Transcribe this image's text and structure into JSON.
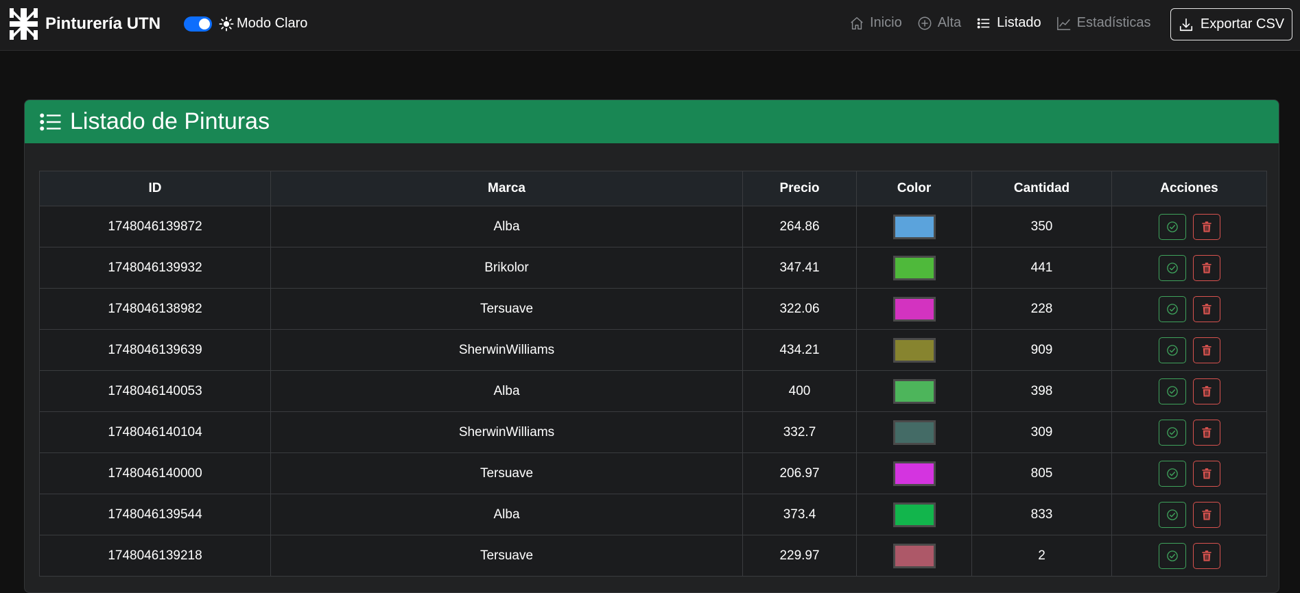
{
  "app": {
    "title": "Pinturería UTN"
  },
  "theme": {
    "label": "Modo Claro",
    "toggle_on": true
  },
  "nav": {
    "items": [
      {
        "label": "Inicio",
        "icon": "house-icon",
        "active": false
      },
      {
        "label": "Alta",
        "icon": "plus-circle-icon",
        "active": false
      },
      {
        "label": "Listado",
        "icon": "list-icon",
        "active": true
      },
      {
        "label": "Estadísticas",
        "icon": "chart-icon",
        "active": false
      }
    ],
    "export_label": "Exportar CSV"
  },
  "card": {
    "title": "Listado de Pinturas"
  },
  "table": {
    "headers": [
      "ID",
      "Marca",
      "Precio",
      "Color",
      "Cantidad",
      "Acciones"
    ],
    "rows": [
      {
        "id": "1748046139872",
        "marca": "Alba",
        "precio": "264.86",
        "color": "#5ba3dc",
        "cantidad": "350"
      },
      {
        "id": "1748046139932",
        "marca": "Brikolor",
        "precio": "347.41",
        "color": "#4fb93b",
        "cantidad": "441"
      },
      {
        "id": "1748046138982",
        "marca": "Tersuave",
        "precio": "322.06",
        "color": "#d333c0",
        "cantidad": "228"
      },
      {
        "id": "1748046139639",
        "marca": "SherwinWilliams",
        "precio": "434.21",
        "color": "#87842f",
        "cantidad": "909"
      },
      {
        "id": "1748046140053",
        "marca": "Alba",
        "precio": "400",
        "color": "#4db55b",
        "cantidad": "398"
      },
      {
        "id": "1748046140104",
        "marca": "SherwinWilliams",
        "precio": "332.7",
        "color": "#446b66",
        "cantidad": "309"
      },
      {
        "id": "1748046140000",
        "marca": "Tersuave",
        "precio": "206.97",
        "color": "#d434e0",
        "cantidad": "805"
      },
      {
        "id": "1748046139544",
        "marca": "Alba",
        "precio": "373.4",
        "color": "#12b54c",
        "cantidad": "833"
      },
      {
        "id": "1748046139218",
        "marca": "Tersuave",
        "precio": "229.97",
        "color": "#ad5868",
        "cantidad": "2"
      }
    ]
  },
  "colors": {
    "accent": "#198754",
    "toggle": "#0d6efd",
    "ok": "#3fa35c",
    "danger": "#d9534f"
  }
}
